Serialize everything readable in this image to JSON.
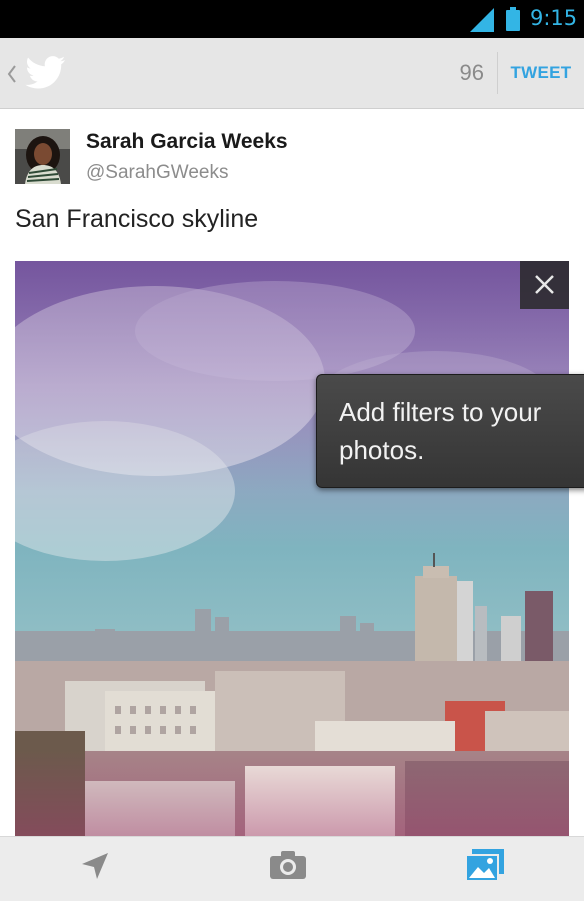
{
  "status_bar": {
    "time": "9:15",
    "icons": [
      "signal-icon",
      "battery-icon"
    ],
    "accent_color": "#33b5e5"
  },
  "action_bar": {
    "icons": [
      "up-caret-icon",
      "twitter-bird-icon"
    ],
    "char_count": "96",
    "tweet_button": "TWEET",
    "tweet_color": "#33a3e0"
  },
  "author": {
    "name": "Sarah Garcia Weeks",
    "handle": "@SarahGWeeks"
  },
  "tweet": {
    "text": "San Francisco skyline"
  },
  "photo": {
    "remove_icon": "close-icon"
  },
  "tooltip": {
    "text": "Add filters to your photos."
  },
  "bottom_bar": {
    "items": [
      {
        "icon": "location-icon",
        "active": false
      },
      {
        "icon": "camera-icon",
        "active": false
      },
      {
        "icon": "gallery-icon",
        "active": true
      }
    ],
    "active_color": "#33a3e0"
  }
}
